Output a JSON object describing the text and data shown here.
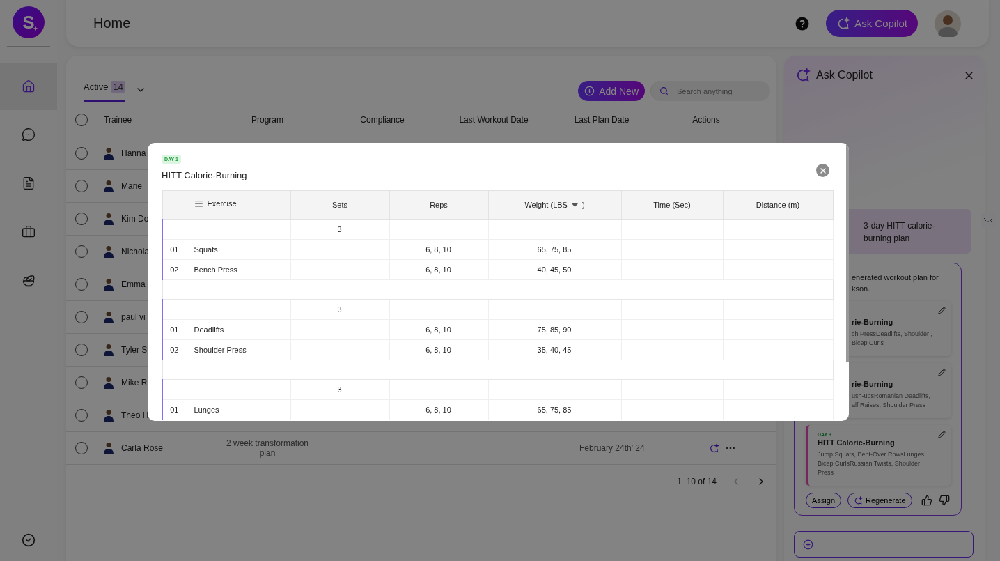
{
  "sidebar": {
    "logo": "S",
    "nav": [
      {
        "selected": true
      },
      {
        "selected": false
      },
      {
        "selected": false
      },
      {
        "selected": false
      },
      {
        "selected": false
      }
    ]
  },
  "header": {
    "title": "Home",
    "copilot_button": "Ask Copilot"
  },
  "trainees": {
    "tab": {
      "label": "Active",
      "count": "14",
      "selected": true
    },
    "add_button": "Add New",
    "search": {
      "placeholder": "Search anything"
    },
    "columns": [
      "Trainee",
      "Program",
      "Compliance",
      "Last Workout Date",
      "Last Plan Date",
      "Actions"
    ],
    "select_all": {
      "checked": false
    },
    "rows": [
      {
        "name": "Hanna",
        "checked": false,
        "actions_visible": false
      },
      {
        "name": "Marie",
        "checked": false,
        "actions_visible": false
      },
      {
        "name": "Kim Do",
        "checked": false,
        "actions_visible": false
      },
      {
        "name": "Nichola",
        "checked": false,
        "actions_visible": false
      },
      {
        "name": "Emma",
        "checked": false,
        "actions_visible": false
      },
      {
        "name": "paul vi",
        "checked": false,
        "actions_visible": false
      },
      {
        "name": "Tyler S",
        "checked": false,
        "actions_visible": false
      },
      {
        "name": "Mike R",
        "checked": false,
        "actions_visible": false
      },
      {
        "name": "Theo H",
        "checked": false,
        "actions_visible": false
      },
      {
        "name": "Carla Rose",
        "checked": false,
        "program": "2 week transformation plan",
        "last_plan_date": "February 24th' 24",
        "actions_visible": true
      }
    ],
    "pagination": "1–10 of 14"
  },
  "copilot": {
    "title": "Ask Copilot",
    "user_message": "3-day HITT calorie-burning plan",
    "reply": "enerated workout plan for kson.",
    "plans": [
      {
        "title": "rie-Burning",
        "exercises": "ch PressDeadlifts, Shoulder , Bicep Curls",
        "covered": true
      },
      {
        "title": "rie-Burning",
        "exercises": "ush-upsRomanian Deadlifts, alf Raises, Shoulder Press",
        "covered": true
      },
      {
        "day": "DAY 3",
        "title": "HITT Calorie-Burning",
        "exercises": "Jump Squats, Bent-Over RowsLunges, Bicep CurlsRussian Twists, Shoulder Press",
        "covered": false
      }
    ],
    "buttons": [
      "Assign",
      "Regenerate"
    ]
  },
  "modal": {
    "day": "DAY 1",
    "title": "HITT Calorie-Burning",
    "columns": {
      "exercise": "Exercise",
      "sets": "Sets",
      "reps": "Reps",
      "weight": "Weight (LBS",
      "weight_suffix": ")",
      "time": "Time (Sec)",
      "distance": "Distance (m)"
    },
    "groups": [
      {
        "sets": "3",
        "exercises": [
          {
            "number": "01",
            "name": "Squats",
            "reps": "6, 8, 10",
            "weight": "65, 75, 85"
          },
          {
            "number": "02",
            "name": "Bench Press",
            "reps": "6, 8, 10",
            "weight": "40, 45, 50"
          }
        ]
      },
      {
        "sets": "3",
        "exercises": [
          {
            "number": "01",
            "name": "Deadlifts",
            "reps": "6, 8, 10",
            "weight": "75, 85, 90"
          },
          {
            "number": "02",
            "name": "Shoulder Press",
            "reps": "6, 8, 10",
            "weight": "35, 40, 45"
          }
        ]
      },
      {
        "sets": "3",
        "exercises": [
          {
            "number": "01",
            "name": "Lunges",
            "reps": "6, 8, 10",
            "weight": "65, 75, 85"
          }
        ]
      }
    ]
  }
}
